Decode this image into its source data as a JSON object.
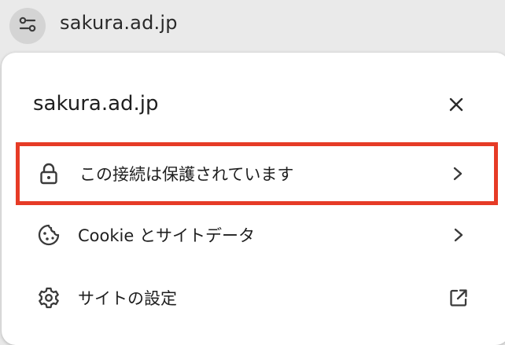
{
  "addressbar": {
    "url": "sakura.ad.jp",
    "site_info_icon": "tune-icon"
  },
  "popup": {
    "title": "sakura.ad.jp",
    "close_icon": "close-icon",
    "items": [
      {
        "label": "この接続は保護されています",
        "icon": "lock-icon",
        "trailing_icon": "chevron-right-icon",
        "highlighted": true,
        "highlight_color": "#e63b26"
      },
      {
        "label": "Cookie とサイトデータ",
        "icon": "cookie-icon",
        "trailing_icon": "chevron-right-icon"
      },
      {
        "label": "サイトの設定",
        "icon": "gear-icon",
        "trailing_icon": "open-in-new-icon"
      }
    ]
  }
}
